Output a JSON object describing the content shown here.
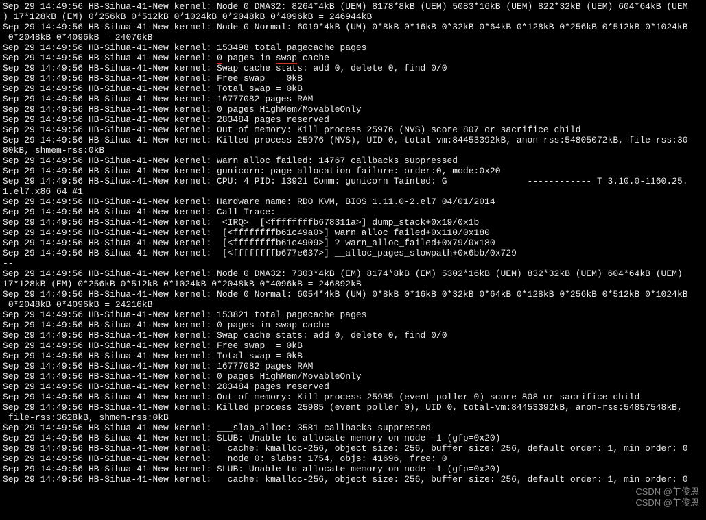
{
  "prefix": "Sep 29 14:49:56 HB-Sihua-41-New kernel: ",
  "lines": [
    {
      "t": "pw",
      "a": "Sep 29 14:49:56 HB-Sihua-41-New kernel: Node 0 DMA32: 8264*4kB (UEM) 8178*8kB (UEM) 5083*16kB (UEM) 822*32kB (UEM) 604*64kB (UEM",
      "b": ") 17*128kB (EM) 0*256kB 0*512kB 0*1024kB 0*2048kB 0*4096kB = 246944kB"
    },
    {
      "t": "pw",
      "a": "Sep 29 14:49:56 HB-Sihua-41-New kernel: Node 0 Normal: 6019*4kB (UM) 0*8kB 0*16kB 0*32kB 0*64kB 0*128kB 0*256kB 0*512kB 0*1024kB",
      "b": " 0*2048kB 0*4096kB = 24076kB"
    },
    {
      "t": "p",
      "m": "153498 total pagecache pages"
    },
    {
      "t": "u",
      "pre": "",
      "u1": "0",
      "mid": " pages in ",
      "u2": "swap",
      "post": " cache"
    },
    {
      "t": "p",
      "m": "Swap cache stats: add 0, delete 0, find 0/0"
    },
    {
      "t": "p",
      "m": "Free swap  = 0kB"
    },
    {
      "t": "p",
      "m": "Total swap = 0kB"
    },
    {
      "t": "p",
      "m": "16777082 pages RAM"
    },
    {
      "t": "p",
      "m": "0 pages HighMem/MovableOnly"
    },
    {
      "t": "p",
      "m": "283484 pages reserved"
    },
    {
      "t": "p",
      "m": "Out of memory: Kill process 25976 (NVS) score 807 or sacrifice child"
    },
    {
      "t": "pw",
      "a": "Sep 29 14:49:56 HB-Sihua-41-New kernel: Killed process 25976 (NVS), UID 0, total-vm:84453392kB, anon-rss:54805072kB, file-rss:30",
      "b": "80kB, shmem-rss:0kB"
    },
    {
      "t": "p",
      "m": "warn_alloc_failed: 14767 callbacks suppressed"
    },
    {
      "t": "p",
      "m": "gunicorn: page allocation failure: order:0, mode:0x20"
    },
    {
      "t": "pw",
      "a": "Sep 29 14:49:56 HB-Sihua-41-New kernel: CPU: 4 PID: 13921 Comm: gunicorn Tainted: G               ------------ T 3.10.0-1160.25.",
      "b": "1.el7.x86_64 #1"
    },
    {
      "t": "p",
      "m": "Hardware name: RDO KVM, BIOS 1.11.0-2.el7 04/01/2014"
    },
    {
      "t": "p",
      "m": "Call Trace:"
    },
    {
      "t": "p",
      "m": " <IRQ>  [<ffffffffb678311a>] dump_stack+0x19/0x1b"
    },
    {
      "t": "p",
      "m": " [<ffffffffb61c49a0>] warn_alloc_failed+0x110/0x180"
    },
    {
      "t": "p",
      "m": " [<ffffffffb61c4909>] ? warn_alloc_failed+0x79/0x180"
    },
    {
      "t": "p",
      "m": " [<ffffffffb677e637>] __alloc_pages_slowpath+0x6bb/0x729"
    },
    {
      "t": "r",
      "m": "--"
    },
    {
      "t": "pw",
      "a": "Sep 29 14:49:56 HB-Sihua-41-New kernel: Node 0 DMA32: 7303*4kB (EM) 8174*8kB (EM) 5302*16kB (UEM) 832*32kB (UEM) 604*64kB (UEM) ",
      "b": "17*128kB (EM) 0*256kB 0*512kB 0*1024kB 0*2048kB 0*4096kB = 246892kB"
    },
    {
      "t": "pw",
      "a": "Sep 29 14:49:56 HB-Sihua-41-New kernel: Node 0 Normal: 6054*4kB (UM) 0*8kB 0*16kB 0*32kB 0*64kB 0*128kB 0*256kB 0*512kB 0*1024kB",
      "b": " 0*2048kB 0*4096kB = 24216kB"
    },
    {
      "t": "p",
      "m": "153821 total pagecache pages"
    },
    {
      "t": "p",
      "m": "0 pages in swap cache"
    },
    {
      "t": "p",
      "m": "Swap cache stats: add 0, delete 0, find 0/0"
    },
    {
      "t": "p",
      "m": "Free swap  = 0kB"
    },
    {
      "t": "p",
      "m": "Total swap = 0kB"
    },
    {
      "t": "p",
      "m": "16777082 pages RAM"
    },
    {
      "t": "p",
      "m": "0 pages HighMem/MovableOnly"
    },
    {
      "t": "p",
      "m": "283484 pages reserved"
    },
    {
      "t": "p",
      "m": "Out of memory: Kill process 25985 (event poller 0) score 808 or sacrifice child"
    },
    {
      "t": "pw",
      "a": "Sep 29 14:49:56 HB-Sihua-41-New kernel: Killed process 25985 (event poller 0), UID 0, total-vm:84453392kB, anon-rss:54857548kB,",
      "b": " file-rss:3628kB, shmem-rss:0kB"
    },
    {
      "t": "p",
      "m": "___slab_alloc: 3581 callbacks suppressed"
    },
    {
      "t": "p",
      "m": "SLUB: Unable to allocate memory on node -1 (gfp=0x20)"
    },
    {
      "t": "p",
      "m": "  cache: kmalloc-256, object size: 256, buffer size: 256, default order: 1, min order: 0"
    },
    {
      "t": "p",
      "m": "  node 0: slabs: 1754, objs: 41696, free: 0"
    },
    {
      "t": "p",
      "m": "SLUB: Unable to allocate memory on node -1 (gfp=0x20)"
    },
    {
      "t": "p",
      "m": "  cache: kmalloc-256, object size: 256, buffer size: 256, default order: 1, min order: 0"
    }
  ],
  "watermark": {
    "top": "CSDN @羊俊恩",
    "bot": "CSDN @羊俊恩"
  }
}
